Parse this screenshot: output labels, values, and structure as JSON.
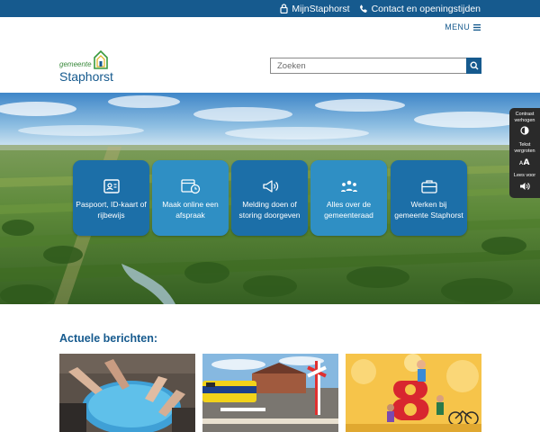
{
  "topbar": {
    "links": [
      {
        "label": "MijnStaphorst",
        "icon": "lock-icon"
      },
      {
        "label": "Contact en openingstijden",
        "icon": "phone-icon"
      }
    ]
  },
  "menu": {
    "label": "MENU",
    "icon": "hamburger-icon"
  },
  "logo": {
    "small": "gemeente",
    "big": "Staphorst"
  },
  "search": {
    "placeholder": "Zoeken",
    "icon": "search-icon"
  },
  "tiles": [
    {
      "label": "Paspoort, ID-kaart of rijbewijs",
      "icon": "id-card-icon"
    },
    {
      "label": "Maak online een afspraak",
      "icon": "calendar-clock-icon"
    },
    {
      "label": "Melding doen of storing doorgeven",
      "icon": "megaphone-icon"
    },
    {
      "label": "Alles over de gemeenteraad",
      "icon": "council-icon"
    },
    {
      "label": "Werken bij gemeente Staphorst",
      "icon": "briefcase-icon"
    }
  ],
  "accessibility": [
    {
      "label": "Contrast verhogen",
      "icon": "contrast-icon"
    },
    {
      "label": "Tekst vergroten",
      "icon": "text-size-icon"
    },
    {
      "label": "Lees voor",
      "icon": "speaker-icon"
    }
  ],
  "news": {
    "title": "Actuele berichten:",
    "cards": [
      {
        "image": "feet-in-water-photo"
      },
      {
        "image": "train-level-crossing-photo"
      },
      {
        "image": "festival-illustration"
      }
    ]
  },
  "colors": {
    "primary": "#165a8e",
    "tile": "#1c6fa8",
    "tile_light": "#2f8fc4",
    "panel": "#2a2a2a"
  }
}
